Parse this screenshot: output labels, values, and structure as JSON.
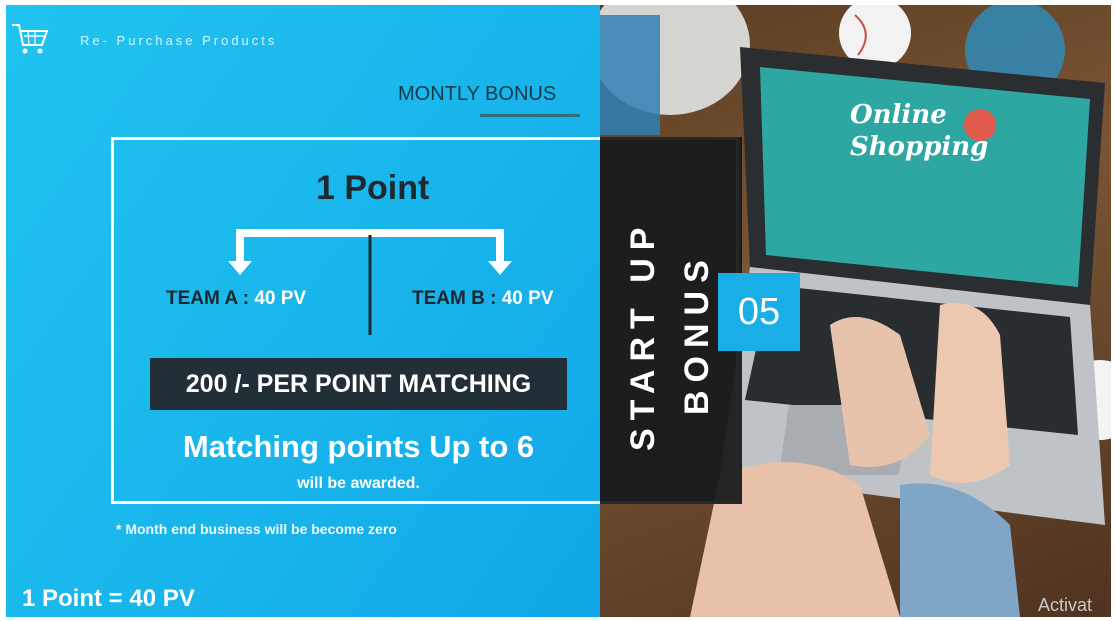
{
  "header": {
    "title": "Re- Purchase Products",
    "icon": "shopping-cart-icon"
  },
  "section_label": "MONTLY BONUS",
  "bonus_box": {
    "point_title": "1 Point",
    "team_a": {
      "label": "TEAM A :",
      "value": "40 PV"
    },
    "team_b": {
      "label": "TEAM B :",
      "value": "40 PV"
    },
    "matching_rate": "200 /- PER POINT MATCHING",
    "matching_points": "Matching points Up to 6",
    "awarded": "will be awarded."
  },
  "note": "* Month end business will be become zero",
  "formula": "1 Point = 40 PV",
  "startup": {
    "line1": "START UP",
    "line2": "BONUS",
    "number": "05"
  },
  "photo": {
    "screen_text_line1": "Online",
    "screen_text_line2": "Shopping"
  },
  "watermark": "Activat",
  "colors": {
    "accent": "#1ab8ec",
    "dark": "#232f36",
    "white": "#ffffff"
  }
}
